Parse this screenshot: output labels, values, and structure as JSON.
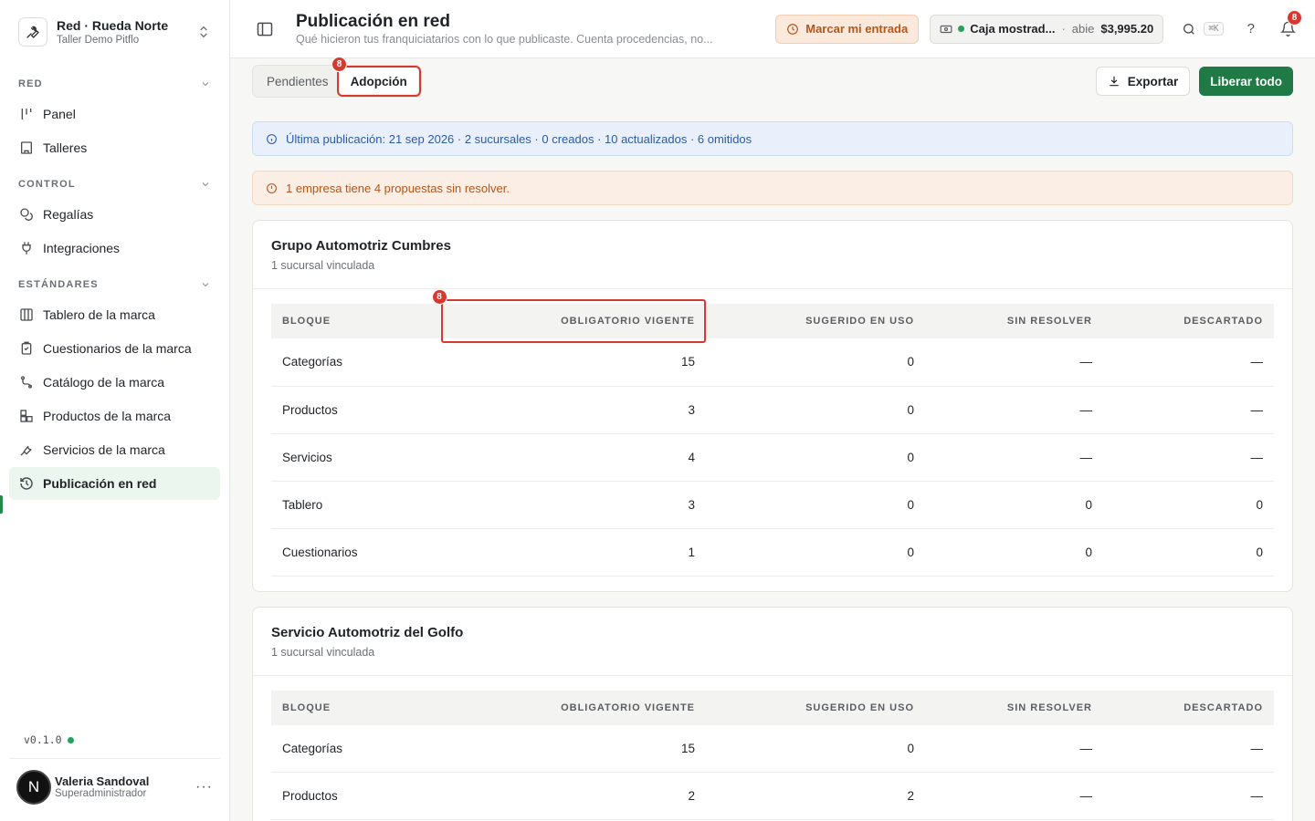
{
  "workspace": {
    "title": "Red · Rueda Norte",
    "subtitle": "Taller Demo Pitflo"
  },
  "sidebar": {
    "sections": [
      {
        "label": "RED",
        "items": [
          {
            "label": "Panel",
            "icon": "kanban-icon"
          },
          {
            "label": "Talleres",
            "icon": "building-icon"
          }
        ]
      },
      {
        "label": "CONTROL",
        "items": [
          {
            "label": "Regalías",
            "icon": "coins-icon"
          },
          {
            "label": "Integraciones",
            "icon": "plug-icon"
          }
        ]
      },
      {
        "label": "ESTÁNDARES",
        "items": [
          {
            "label": "Tablero de la marca",
            "icon": "columns-icon"
          },
          {
            "label": "Cuestionarios de la marca",
            "icon": "clipboard-icon"
          },
          {
            "label": "Catálogo de la marca",
            "icon": "route-icon"
          },
          {
            "label": "Productos de la marca",
            "icon": "boxes-icon"
          },
          {
            "label": "Servicios de la marca",
            "icon": "wrench-icon"
          },
          {
            "label": "Publicación en red",
            "icon": "history-icon",
            "active": true
          }
        ]
      }
    ],
    "version": "v0.1.0",
    "user": {
      "initial": "N",
      "name": "Valeria Sandoval",
      "role": "Superadministrador"
    }
  },
  "header": {
    "title": "Publicación en red",
    "subtitle": "Qué hicieron tus franquiciatarios con lo que publicaste. Cuenta procedencias, no...",
    "clock_in_label": "Marcar mi entrada",
    "cash": {
      "name": "Caja mostrad...",
      "separator": "·",
      "state": "abie",
      "amount": "$3,995.20"
    },
    "search_shortcut": "⌘K",
    "help_label": "?",
    "notifications_count": "8"
  },
  "tabs": {
    "items": [
      "Pendientes",
      "Adopción"
    ],
    "active_index": 1,
    "badge": "8"
  },
  "actions": {
    "export_label": "Exportar",
    "release_label": "Liberar todo"
  },
  "alerts": {
    "info": "Última publicación: 21 sep 2026 · 2 sucursales · 0 creados · 10 actualizados · 6 omitidos",
    "warning": "1 empresa tiene 4 propuestas sin resolver."
  },
  "table_columns": [
    "BLOQUE",
    "OBLIGATORIO VIGENTE",
    "SUGERIDO EN USO",
    "SIN RESOLVER",
    "DESCARTADO"
  ],
  "column_badge": "8",
  "companies": [
    {
      "name": "Grupo Automotriz Cumbres",
      "subtitle": "1 sucursal vinculada",
      "rows": [
        [
          "Categorías",
          "15",
          "0",
          "—",
          "—"
        ],
        [
          "Productos",
          "3",
          "0",
          "—",
          "—"
        ],
        [
          "Servicios",
          "4",
          "0",
          "—",
          "—"
        ],
        [
          "Tablero",
          "3",
          "0",
          "0",
          "0"
        ],
        [
          "Cuestionarios",
          "1",
          "0",
          "0",
          "0"
        ]
      ]
    },
    {
      "name": "Servicio Automotriz del Golfo",
      "subtitle": "1 sucursal vinculada",
      "rows": [
        [
          "Categorías",
          "15",
          "0",
          "—",
          "—"
        ],
        [
          "Productos",
          "2",
          "2",
          "—",
          "—"
        ]
      ]
    }
  ]
}
